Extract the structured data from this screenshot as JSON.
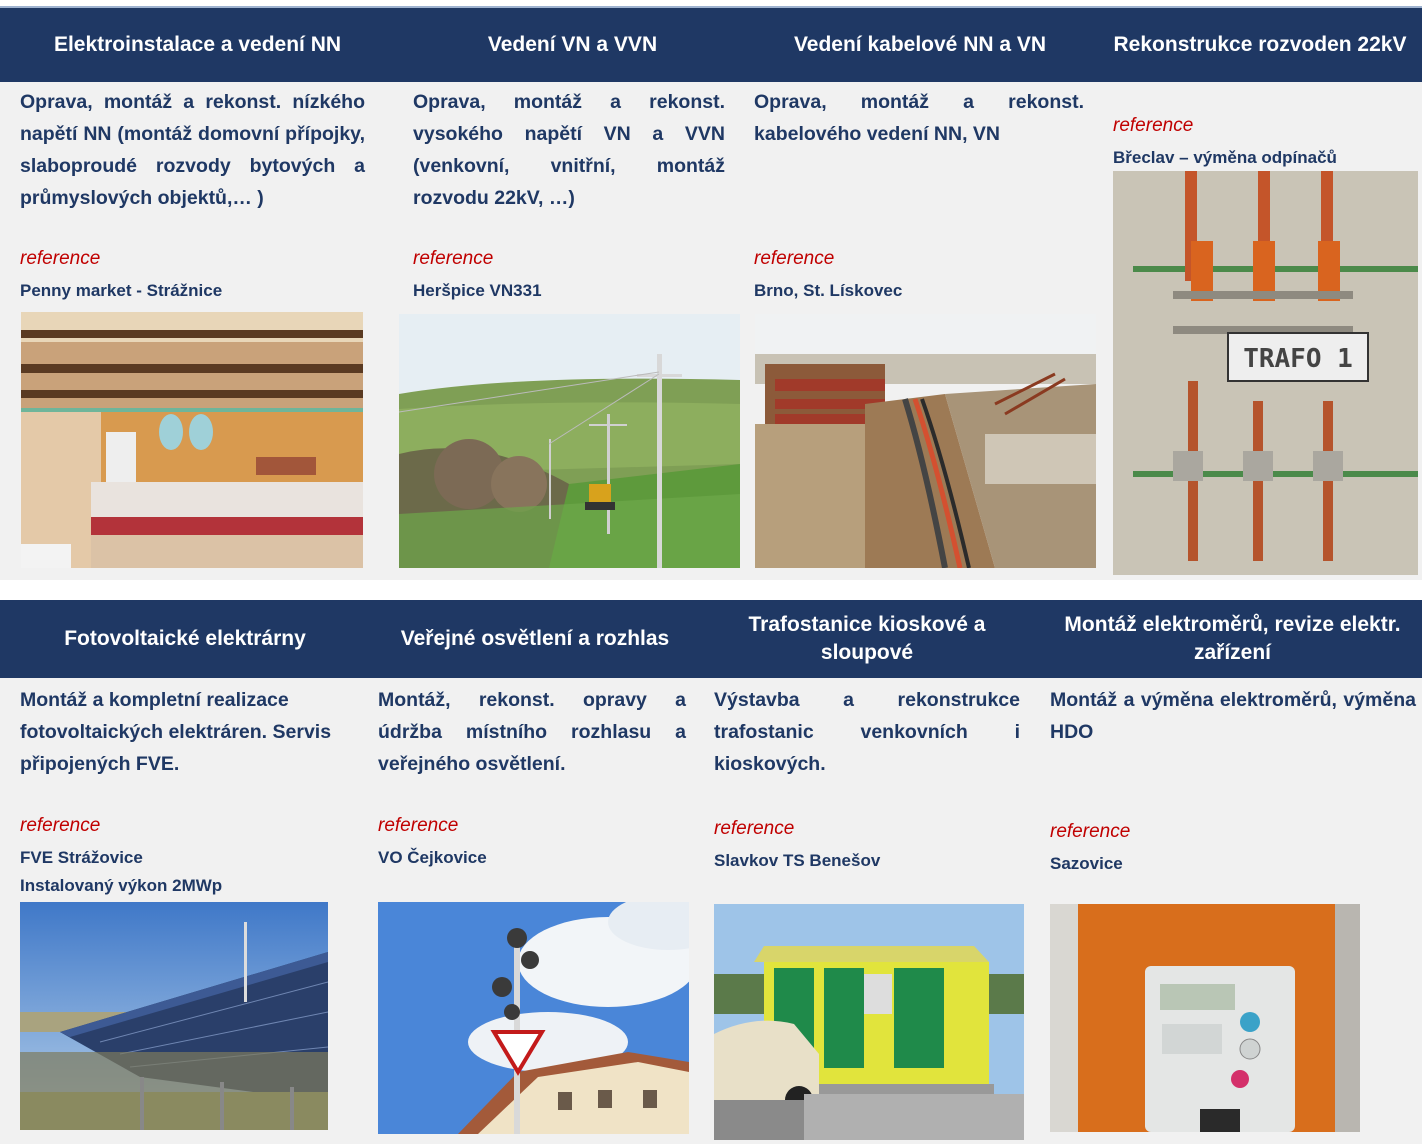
{
  "row1": [
    {
      "heading": "Elektroinstalace a vedení NN",
      "description": "Oprava, montáž a rekonst. nízkého napětí NN (montáž domovní přípojky, slaboproudé rozvody bytových a průmyslových objektů,… )",
      "ref_label": "reference",
      "place": "Penny market - Strážnice",
      "photo": "store-interior-photo"
    },
    {
      "heading": "Vedení VN a VVN",
      "description": "Oprava, montáž a rekonst. vysokého napětí VN a VVN (venkovní, vnitřní, montáž rozvodu 22kV, …)",
      "ref_label": "reference",
      "place": "Heršpice VN331",
      "photo": "power-line-field-photo"
    },
    {
      "heading": "Vedení kabelové NN a VN",
      "description": "Oprava, montáž a rekonst. kabelového vedení NN, VN",
      "ref_label": "reference",
      "place": "Brno, St. Lískovec",
      "photo": "cable-trench-photo"
    },
    {
      "heading": "Rekonstrukce rozvoden 22kV",
      "ref_label": "reference",
      "place": "Břeclav – výměna odpínačů",
      "photo": "switchgear-trafo-photo",
      "photo_sign": "TRAFO 1"
    }
  ],
  "row2": [
    {
      "heading": "Fotovoltaické elektrárny",
      "description": "Montáž a kompletní realizace fotovoltaických elektráren. Servis připojených FVE.",
      "ref_label": "reference",
      "place": "FVE Strážovice",
      "place2": "Instalovaný výkon 2MWp",
      "photo": "solar-panels-photo"
    },
    {
      "heading": "Veřejné osvětlení a rozhlas",
      "description": "Montáž, rekonst. opravy a údržba místního rozhlasu a veřejného osvětlení.",
      "ref_label": "reference",
      "place": "VO Čejkovice",
      "photo": "street-lamp-speaker-photo"
    },
    {
      "heading": "Trafostanice kioskové a sloupové",
      "description": "Výstavba a rekonstrukce trafostanic venkovních i kioskových.",
      "ref_label": "reference",
      "place": "Slavkov TS Benešov",
      "photo": "kiosk-substation-photo"
    },
    {
      "heading": "Montáž elektroměrů, revize elektr. zařízení",
      "description": "Montáž a výměna elektroměrů, výměna HDO",
      "ref_label": "reference",
      "place": "Sazovice",
      "photo": "electricity-meter-photo"
    }
  ],
  "colors": {
    "band": "#1f3864",
    "text_blue": "#1f3864",
    "reference_red": "#c00000",
    "background": "#f1f1f1"
  }
}
